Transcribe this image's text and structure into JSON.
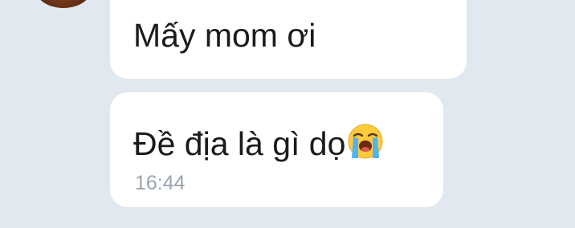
{
  "messages": [
    {
      "text": "Mấy mom ơi"
    },
    {
      "text": "Đề địa là gì dọ",
      "emoji": "loudly-crying-face-emoji",
      "time": "16:44"
    }
  ],
  "colors": {
    "background": "#e2e8ef",
    "bubble": "#ffffff",
    "text": "#1b1b1b",
    "timestamp": "#9aa3ad"
  }
}
